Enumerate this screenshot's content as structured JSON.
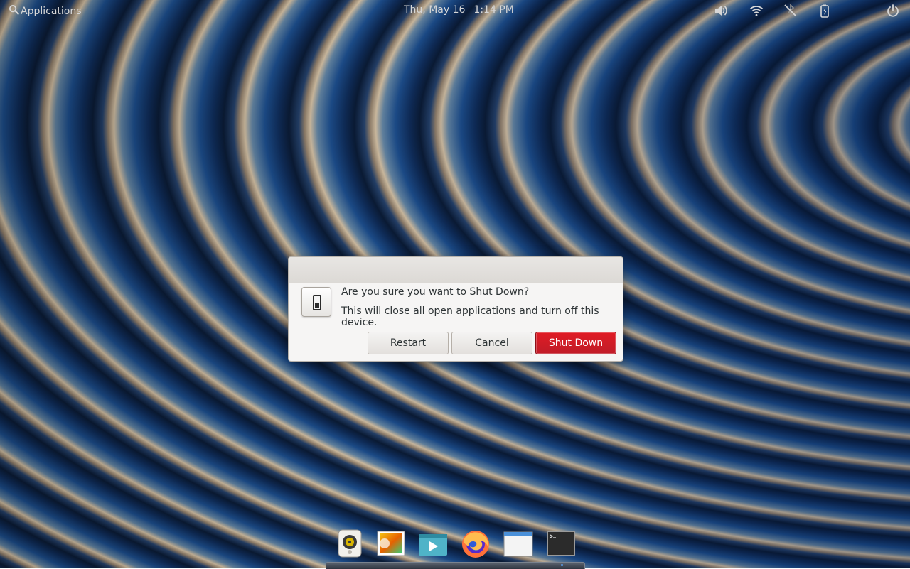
{
  "top_panel": {
    "applications_label": "Applications",
    "date": "Thu, May 16",
    "time": "1:14 PM",
    "tray_icons": [
      "volume-icon",
      "wifi-icon",
      "bluetooth-disabled-icon",
      "battery-charging-icon",
      "power-icon"
    ]
  },
  "dialog": {
    "title": "Are you sure you want to Shut Down?",
    "message": "This will close all open applications and turn off this device.",
    "icon": "system-shutdown-switch-icon",
    "buttons": {
      "restart": "Restart",
      "cancel": "Cancel",
      "shut_down": "Shut Down"
    },
    "destructive_color": "#e01b24"
  },
  "dock": {
    "items": [
      "music-app-icon",
      "photos-app-icon",
      "videos-app-icon",
      "firefox-icon",
      "files-app-icon",
      "terminal-icon"
    ]
  },
  "colors": {
    "panel_text": "#d7d7d7",
    "dialog_bg": "#f6f5f4",
    "shutdown_button": "#e01b24"
  }
}
